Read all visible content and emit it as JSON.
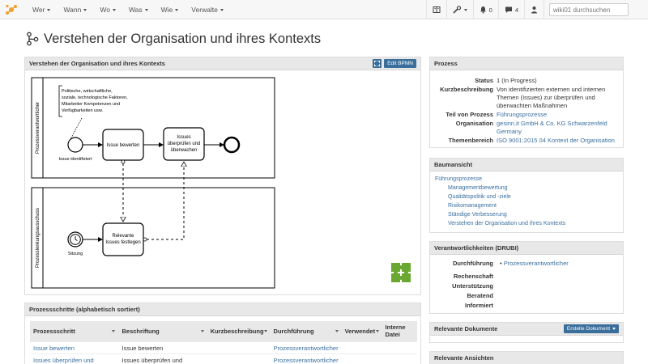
{
  "nav": {
    "menus": [
      "Wer",
      "Wann",
      "Wo",
      "Was",
      "Wie",
      "Verwalte"
    ],
    "notifications_count": "0",
    "comments_count": "4",
    "search_placeholder": "wiki01 durchsuchen"
  },
  "page": {
    "title": "Verstehen der Organisation und ihres Kontexts"
  },
  "diagram": {
    "panel_title": "Verstehen der Organisation und ihres Kontexts",
    "edit_label": "Edit BPMN",
    "lane1": "Prozessverantwortlicher",
    "lane2": "Prozesslenkungsausschuss",
    "annotation": [
      "Politische, wirtschaftliche,",
      "soziale, technologische Faktoren,",
      "Mitarbeiter Kompetenzen und",
      "Verfügbarkeiten usw."
    ],
    "start_event": "Issue identifiziert",
    "task1": "Issue bewerten",
    "task2": [
      "Issues",
      "überprüfen und",
      "überwachen"
    ],
    "task3": [
      "Relevante",
      "Issues festlegen"
    ],
    "timer_event": "Sitzung"
  },
  "steps": {
    "panel_title": "Prozessschritte (alphabetisch sortiert)",
    "headers": [
      "Prozessschritt",
      "Beschriftung",
      "Kurzbeschreibung",
      "Durchführung",
      "Verwendet",
      "Interne Datei"
    ],
    "rows": [
      [
        "Issue bewerten",
        "Issue bewerten",
        "",
        "Prozessverantwortlicher",
        "",
        ""
      ],
      [
        "Issues überprüfen und",
        "Issues überprüfen und",
        "",
        "Prozessverantwortlicher",
        "",
        ""
      ]
    ]
  },
  "process": {
    "panel_title": "Prozess",
    "status_label": "Status",
    "status": "1 (In Progress)",
    "desc_label": "Kurzbeschreibung",
    "desc": [
      "Von identifizierten externen und internen",
      "Themen (Issues) zur überprüfen und",
      "überwachten Maßnahmen"
    ],
    "part_label": "Teil von Prozess",
    "part": "Führungsprozesse",
    "org_label": "Organisation",
    "org": [
      "gesinn.it GmbH & Co. KG Schwarzenfeld",
      "Germany"
    ],
    "topic_label": "Themenbereich",
    "topic": "ISO 9001:2015 04 Kontext der Organisation"
  },
  "tree": {
    "panel_title": "Baumansicht",
    "root": "Führungsprozesse",
    "children": [
      "Managementbewertung",
      "Qualitätspolitik und -ziele",
      "Risikomanagement",
      "Ständige Verbesserung",
      "Verstehen der Organisation und ihres Kontexts"
    ]
  },
  "drubi": {
    "panel_title": "Verantwortlichkeiten (DRUBI)",
    "d_label": "Durchführung",
    "d_value": "Prozessverantwortlicher",
    "r_label": "Rechenschaft",
    "u_label": "Unterstützung",
    "b_label": "Beratend",
    "i_label": "Informiert"
  },
  "docs": {
    "panel_title": "Relevante Dokumente",
    "create_label": "Erstelle Dokument"
  },
  "views": {
    "panel_title": "Relevante Ansichten"
  },
  "colors": {
    "accent": "#3a6f9c",
    "link": "#3a6fa0",
    "logo": "#f0a030",
    "puzzle": "#6aa832"
  }
}
